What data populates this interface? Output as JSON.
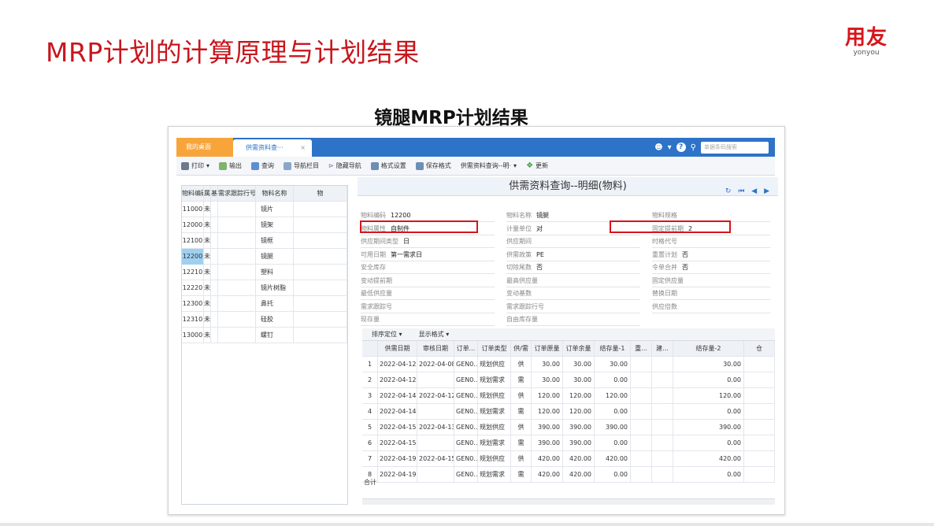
{
  "slide": {
    "title": "MRP计划的计算原理与计划结果",
    "subtitle": "镜腿MRP计划结果",
    "logo_cn": "用友",
    "logo_en": "yonyou"
  },
  "window": {
    "tabs": [
      "我的桌面",
      "供需资料查···"
    ],
    "tab_close": "×",
    "search_placeholder": "单据条码搜索",
    "toolbar": [
      {
        "label": "打印",
        "icon": "printer-icon"
      },
      {
        "label": "输出",
        "icon": "export-icon"
      },
      {
        "label": "查询",
        "icon": "query-icon"
      },
      {
        "label": "导航栏目",
        "icon": "nav-icon"
      },
      {
        "label": "隐藏导航",
        "icon": "hide-nav-icon"
      },
      {
        "label": "格式设置",
        "icon": "format-icon"
      },
      {
        "label": "保存格式",
        "icon": "save-format-icon"
      },
      {
        "label": "供需资料查询--明·",
        "icon": ""
      },
      {
        "label": "更新",
        "icon": "refresh-icon"
      }
    ],
    "left_table": {
      "headers": [
        "物料编码",
        "属",
        "基",
        "需求跟踪行号",
        "物料名称",
        "物"
      ],
      "rows": [
        {
          "code": "11000",
          "attr": "未",
          "name": "镜片"
        },
        {
          "code": "12000",
          "attr": "未",
          "name": "镜架"
        },
        {
          "code": "12100",
          "attr": "未",
          "name": "镜框"
        },
        {
          "code": "12200",
          "attr": "未",
          "name": "镜腿"
        },
        {
          "code": "12210",
          "attr": "未",
          "name": "塑料"
        },
        {
          "code": "12220",
          "attr": "未",
          "name": "镜片树脂"
        },
        {
          "code": "12300",
          "attr": "未",
          "name": "鼻托"
        },
        {
          "code": "12310",
          "attr": "未",
          "name": "硅胶"
        },
        {
          "code": "13000",
          "attr": "未",
          "name": "螺钉"
        }
      ]
    },
    "right_title": "供需资料查询--明细(物料)",
    "right_nav": "↻ ⏮ ◀ ▶",
    "fields": [
      [
        {
          "label": "物料编码",
          "value": "12200"
        },
        {
          "label": "物料名称",
          "value": "镜腿"
        },
        {
          "label": "物料规格",
          "value": ""
        }
      ],
      [
        {
          "label": "物料属性",
          "value": "自制件"
        },
        {
          "label": "计量单位",
          "value": "对"
        },
        {
          "label": "固定提前期",
          "value": "2"
        }
      ],
      [
        {
          "label": "供应期间类型",
          "value": "日"
        },
        {
          "label": "供应期间",
          "value": ""
        },
        {
          "label": "时格代号",
          "value": ""
        }
      ],
      [
        {
          "label": "可用日期",
          "value": "第一需求日"
        },
        {
          "label": "供需政策",
          "value": "PE"
        },
        {
          "label": "重置计划",
          "value": "否"
        }
      ],
      [
        {
          "label": "安全库存",
          "value": ""
        },
        {
          "label": "切除尾数",
          "value": "否"
        },
        {
          "label": "令单合并",
          "value": "否"
        }
      ],
      [
        {
          "label": "变动提前期",
          "value": ""
        },
        {
          "label": "最高供应量",
          "value": ""
        },
        {
          "label": "固定供应量",
          "value": ""
        }
      ],
      [
        {
          "label": "最低供应量",
          "value": ""
        },
        {
          "label": "变动基数",
          "value": ""
        },
        {
          "label": "替换日期",
          "value": ""
        }
      ],
      [
        {
          "label": "需求跟踪号",
          "value": ""
        },
        {
          "label": "需求跟踪行号",
          "value": ""
        },
        {
          "label": "供应倍数",
          "value": ""
        }
      ],
      [
        {
          "label": "现存量",
          "value": ""
        },
        {
          "label": "自由库存量",
          "value": ""
        }
      ]
    ],
    "grid_toolbar": [
      "排序定位 ▾",
      "显示格式 ▾"
    ],
    "grid_headers": [
      "",
      "供需日期",
      "审核日期",
      "订单...",
      "订单类型",
      "供/需",
      "订单原量",
      "订单余量",
      "结存量-1",
      "重...",
      "建...",
      "结存量-2",
      "仓"
    ],
    "grid_rows": [
      [
        "1",
        "2022-04-12",
        "2022-04-08",
        "GEN0...",
        "规划供应",
        "供",
        "30.00",
        "30.00",
        "30.00",
        "",
        "",
        "30.00"
      ],
      [
        "2",
        "2022-04-12",
        "",
        "GEN0...",
        "规划需求",
        "需",
        "30.00",
        "30.00",
        "0.00",
        "",
        "",
        "0.00"
      ],
      [
        "3",
        "2022-04-14",
        "2022-04-12",
        "GEN0...",
        "规划供应",
        "供",
        "120.00",
        "120.00",
        "120.00",
        "",
        "",
        "120.00"
      ],
      [
        "4",
        "2022-04-14",
        "",
        "GEN0...",
        "规划需求",
        "需",
        "120.00",
        "120.00",
        "0.00",
        "",
        "",
        "0.00"
      ],
      [
        "5",
        "2022-04-15",
        "2022-04-13",
        "GEN0...",
        "规划供应",
        "供",
        "390.00",
        "390.00",
        "390.00",
        "",
        "",
        "390.00"
      ],
      [
        "6",
        "2022-04-15",
        "",
        "GEN0...",
        "规划需求",
        "需",
        "390.00",
        "390.00",
        "0.00",
        "",
        "",
        "0.00"
      ],
      [
        "7",
        "2022-04-19",
        "2022-04-15",
        "GEN0...",
        "规划供应",
        "供",
        "420.00",
        "420.00",
        "420.00",
        "",
        "",
        "420.00"
      ],
      [
        "8",
        "2022-04-19",
        "",
        "GEN0...",
        "规划需求",
        "需",
        "420.00",
        "420.00",
        "0.00",
        "",
        "",
        "0.00"
      ]
    ],
    "total_label": "合计"
  },
  "colors": {
    "brand_red": "#c8161d",
    "tab_blue": "#2d73c8",
    "tab_orange": "#f7a53b",
    "selected_row": "#9fd0f0"
  }
}
